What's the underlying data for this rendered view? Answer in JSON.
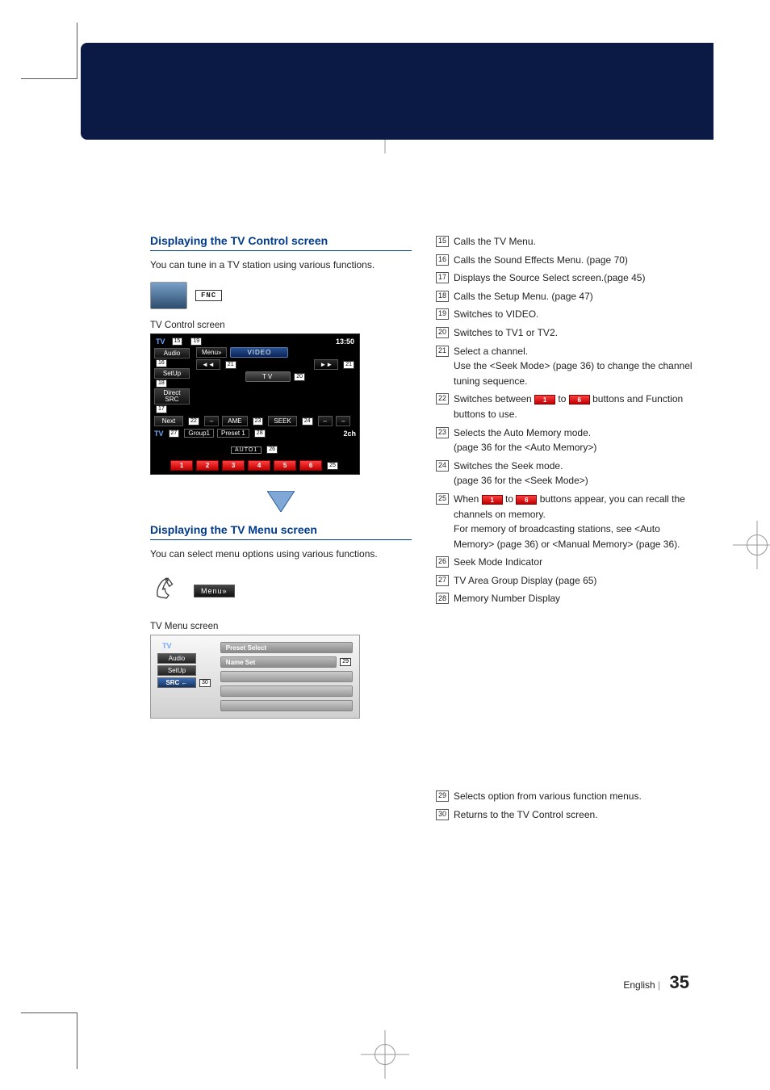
{
  "sec1": {
    "title": "Displaying the TV Control screen",
    "intro": "You can tune in a TV station using various functions.",
    "fnc": "FNC",
    "caption": "TV Control screen"
  },
  "dev1": {
    "tv": "TV",
    "time": "13:50",
    "menu": "Menu»",
    "video": "VIDEO",
    "audio": "Audio",
    "setup": "SetUp",
    "direct": "Direct SRC",
    "next": "Next",
    "tvpill": "TV",
    "ame": "AME",
    "seek": "SEEK",
    "tv2": "TV",
    "group": "Group1",
    "preset": "Preset 1",
    "ch": "2ch",
    "auto": "AUTO1",
    "r1": "1",
    "r2": "2",
    "r3": "3",
    "r4": "4",
    "r5": "5",
    "r6": "6",
    "m15": "15",
    "m16": "16",
    "m17": "17",
    "m18": "18",
    "m19": "19",
    "m20": "20",
    "m21": "21",
    "m22": "22",
    "m23": "23",
    "m24": "24",
    "m25": "25",
    "m26": "26",
    "m27": "27",
    "m28": "28"
  },
  "right": [
    {
      "n": "15",
      "t": "Calls the TV Menu."
    },
    {
      "n": "16",
      "t": "Calls the Sound Effects Menu. (page 70)"
    },
    {
      "n": "17",
      "t": "Displays the Source Select screen.(page 45)"
    },
    {
      "n": "18",
      "t": "Calls the Setup Menu. (page 47)"
    },
    {
      "n": "19",
      "t": "Switches to VIDEO."
    },
    {
      "n": "20",
      "t": "Switches to TV1 or TV2."
    },
    {
      "n": "21",
      "t": "Select a channel.\nUse the <Seek Mode> (page 36) to change the channel tuning sequence."
    },
    {
      "n": "22",
      "t_pre": "Switches between ",
      "t_mid": " to ",
      "t_post": " buttons and Function buttons to use.",
      "b1": "1",
      "b2": "6"
    },
    {
      "n": "23",
      "t": "Selects the Auto Memory mode.\n(page 36 for the <Auto Memory>)"
    },
    {
      "n": "24",
      "t": "Switches the Seek mode.\n(page 36 for the <Seek Mode>)"
    },
    {
      "n": "25",
      "t_pre": "When ",
      "t_mid": " to ",
      "t_post": " buttons appear, you can recall the channels on memory.\nFor memory of broadcasting stations, see <Auto Memory> (page 36) or <Manual Memory> (page 36).",
      "b1": "1",
      "b2": "6"
    },
    {
      "n": "26",
      "t": "Seek Mode Indicator"
    },
    {
      "n": "27",
      "t": "TV Area Group Display (page 65)"
    },
    {
      "n": "28",
      "t": "Memory Number Display"
    }
  ],
  "right2": [
    {
      "n": "29",
      "t": "Selects option from various function menus."
    },
    {
      "n": "30",
      "t": "Returns to the TV Control screen."
    }
  ],
  "sec2": {
    "title": "Displaying the TV Menu screen",
    "intro": "You can select menu options using various functions.",
    "menu": "Menu»",
    "caption": "TV Menu screen"
  },
  "dev2": {
    "tv": "TV",
    "audio": "Audio",
    "setup": "SetUp",
    "src": "SRC ←",
    "preset": "Preset Select",
    "name": "Name Set",
    "m29": "29",
    "m30": "30"
  },
  "footer": {
    "lang": "English",
    "page": "35"
  }
}
